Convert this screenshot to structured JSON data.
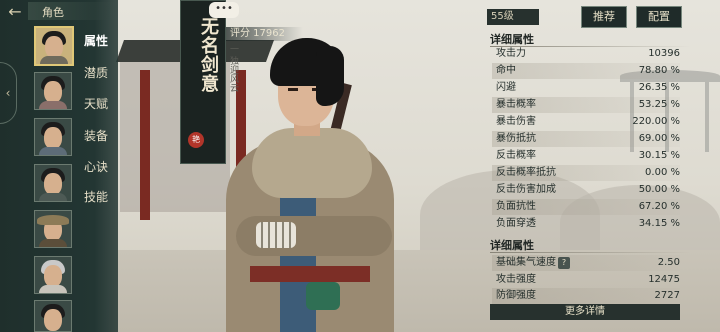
{
  "header": {
    "title": "角色",
    "back_icon": "arrow-left-icon"
  },
  "sidebar": {
    "portraits": [
      {
        "name": "hero-young-swordsman",
        "active": true
      },
      {
        "name": "woman-black-hair"
      },
      {
        "name": "woman-hairpin"
      },
      {
        "name": "man-long-hair"
      },
      {
        "name": "man-straw-hat"
      },
      {
        "name": "woman-white-hair"
      },
      {
        "name": "woman-dark-hair"
      }
    ],
    "menu": [
      {
        "label": "属性",
        "active": true
      },
      {
        "label": "潜质"
      },
      {
        "label": "天赋"
      },
      {
        "label": "装备"
      },
      {
        "label": "心诀"
      },
      {
        "label": "技能"
      }
    ]
  },
  "character": {
    "name": "无名剑意",
    "subtitle": "一 独迎风云",
    "seal": "艳",
    "chat_bubble": "•••",
    "score": "评分 17962"
  },
  "panel": {
    "level": "55级",
    "recommend_button": "推荐",
    "config_button": "配置",
    "section1_title": "详细属性",
    "stats1": [
      {
        "label": "攻击力",
        "value": "10396"
      },
      {
        "label": "命中",
        "value": "78.80 %"
      },
      {
        "label": "闪避",
        "value": "26.35 %"
      },
      {
        "label": "暴击概率",
        "value": "53.25 %"
      },
      {
        "label": "暴击伤害",
        "value": "220.00 %"
      },
      {
        "label": "暴伤抵抗",
        "value": "69.00 %"
      },
      {
        "label": "反击概率",
        "value": "30.15 %"
      },
      {
        "label": "反击概率抵抗",
        "value": "0.00 %"
      },
      {
        "label": "反击伤害加成",
        "value": "50.00 %"
      },
      {
        "label": "负面抗性",
        "value": "67.20 %"
      },
      {
        "label": "负面穿透",
        "value": "34.15 %"
      }
    ],
    "section2_title": "详细属性",
    "stats2": [
      {
        "label": "基础集气速度",
        "value": "2.50"
      },
      {
        "label": "攻击强度",
        "value": "12475"
      },
      {
        "label": "防御强度",
        "value": "2727"
      }
    ],
    "help_icon": "?",
    "more_button": "更多详情"
  }
}
